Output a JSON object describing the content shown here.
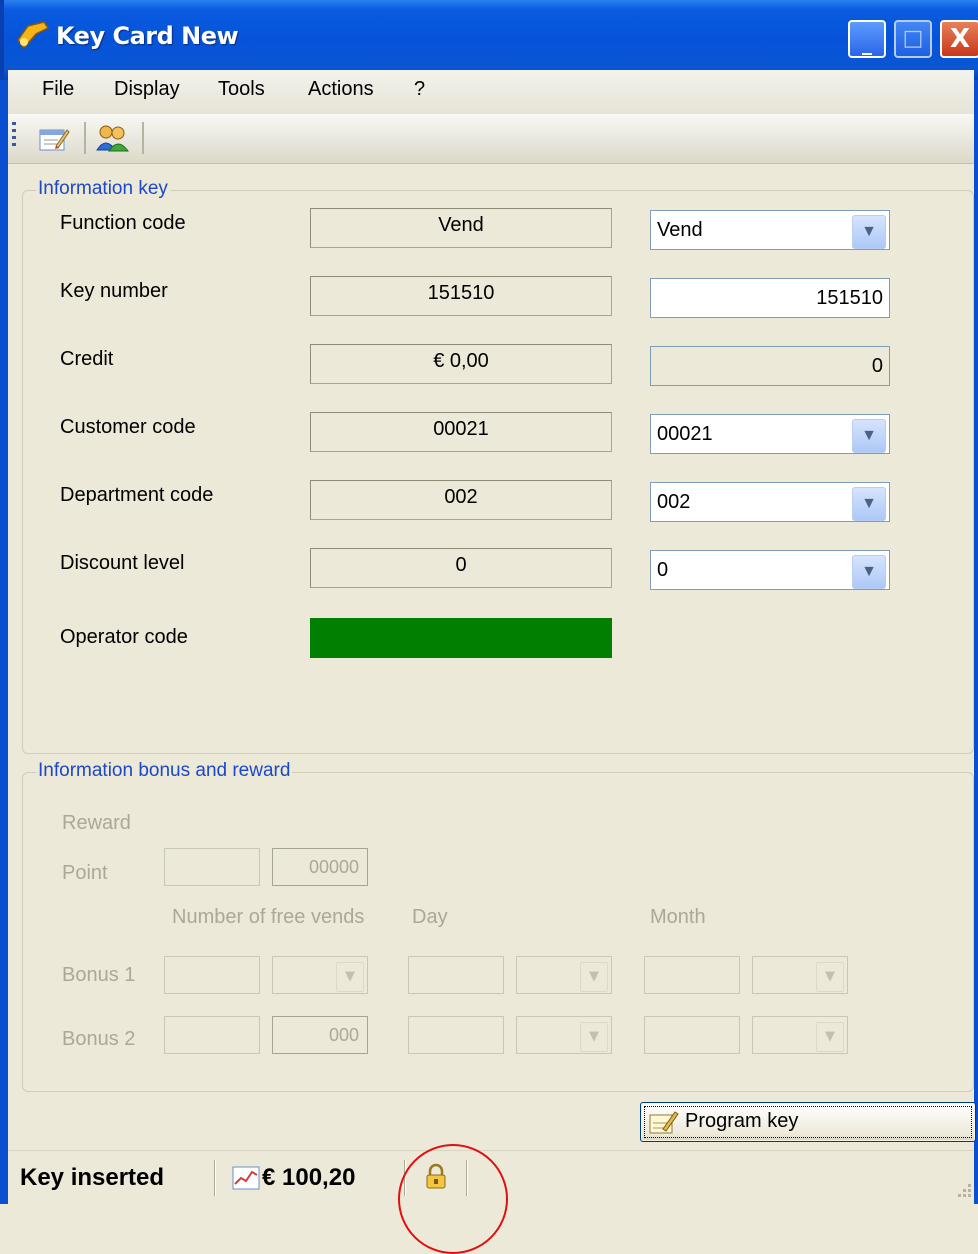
{
  "window": {
    "title": "Key Card New",
    "minimize_glyph": "_",
    "maximize_glyph": "□",
    "close_glyph": "X"
  },
  "menu": [
    "File",
    "Display",
    "Tools",
    "Actions",
    "?"
  ],
  "toolbar": {
    "buttons": [
      "edit-card-icon",
      "users-icon"
    ]
  },
  "info_key": {
    "legend": "Information key",
    "rows": {
      "function_code": {
        "label": "Function code",
        "read": "Vend",
        "value": "Vend"
      },
      "key_number": {
        "label": "Key number",
        "read": "151510",
        "value": "151510"
      },
      "credit": {
        "label": "Credit",
        "read": "€ 0,00",
        "value": "0"
      },
      "customer_code": {
        "label": "Customer code",
        "read": "00021",
        "value": "00021"
      },
      "department_code": {
        "label": "Department code",
        "read": "002",
        "value": "002"
      },
      "discount_level": {
        "label": "Discount level",
        "read": "0",
        "value": "0"
      },
      "operator_code": {
        "label": "Operator code",
        "color": "#007F00"
      }
    }
  },
  "bonus": {
    "legend": "Information bonus and reward",
    "reward_label": "Reward",
    "point_label": "Point",
    "point_value": "00000",
    "col_free_vends": "Number of free vends",
    "col_day": "Day",
    "col_month": "Month",
    "bonus1_label": "Bonus 1",
    "bonus2_label": "Bonus 2",
    "bonus2_value": "000"
  },
  "actions": {
    "program_key": "Program key"
  },
  "status": {
    "state": "Key inserted",
    "balance": "€ 100,20",
    "lock_icon": "lock-icon"
  },
  "colors": {
    "title_blue": "#0553d8",
    "operator_green": "#007F00",
    "group_legend": "#1c48c8"
  }
}
